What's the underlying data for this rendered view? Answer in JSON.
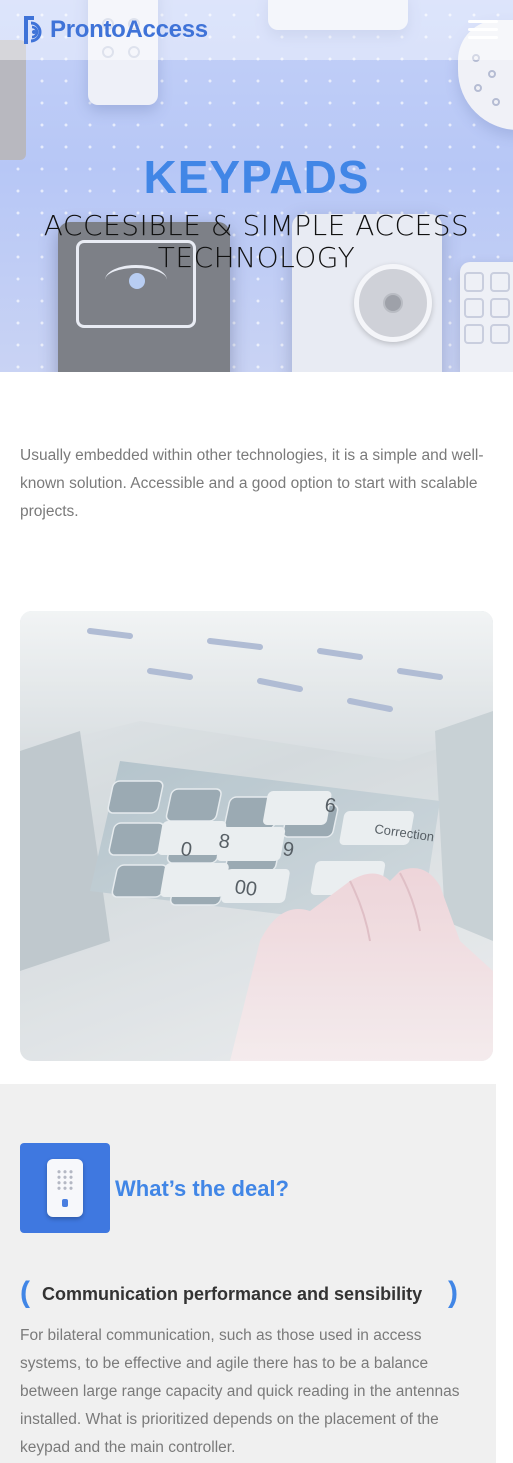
{
  "header": {
    "logo_text": "ProntoAccess",
    "logo_icon": "pronto-logo-icon",
    "menu_icon": "hamburger-menu-icon"
  },
  "hero": {
    "title": "KEYPADS",
    "subtitle": "ACCESIBLE & SIMPLE ACCESS TECHNOLOGY"
  },
  "intro": {
    "text": "Usually embedded within other technologies, it is a simple and well-known solution. Accessible and a good option to start with scalable projects."
  },
  "photo": {
    "keys": [
      "0",
      "00",
      "8",
      "9",
      "6",
      "Correction"
    ]
  },
  "deal": {
    "icon": "keypad-device-icon",
    "title": "What’s the deal?",
    "paren_left": "(",
    "paren_right": ")",
    "subtitle": "Communication performance and sensibility",
    "text": "For bilateral communication, such as those used in access systems, to be effective and agile there has to be a balance between large range capacity and quick reading in the antennas installed. What is prioritized depends on the placement of the keypad and the main controller."
  },
  "colors": {
    "brand_blue": "#4186e6",
    "icon_box_blue": "#3f78e0",
    "body_text": "#7a7a7a",
    "section_bg": "#f0f0f0"
  }
}
